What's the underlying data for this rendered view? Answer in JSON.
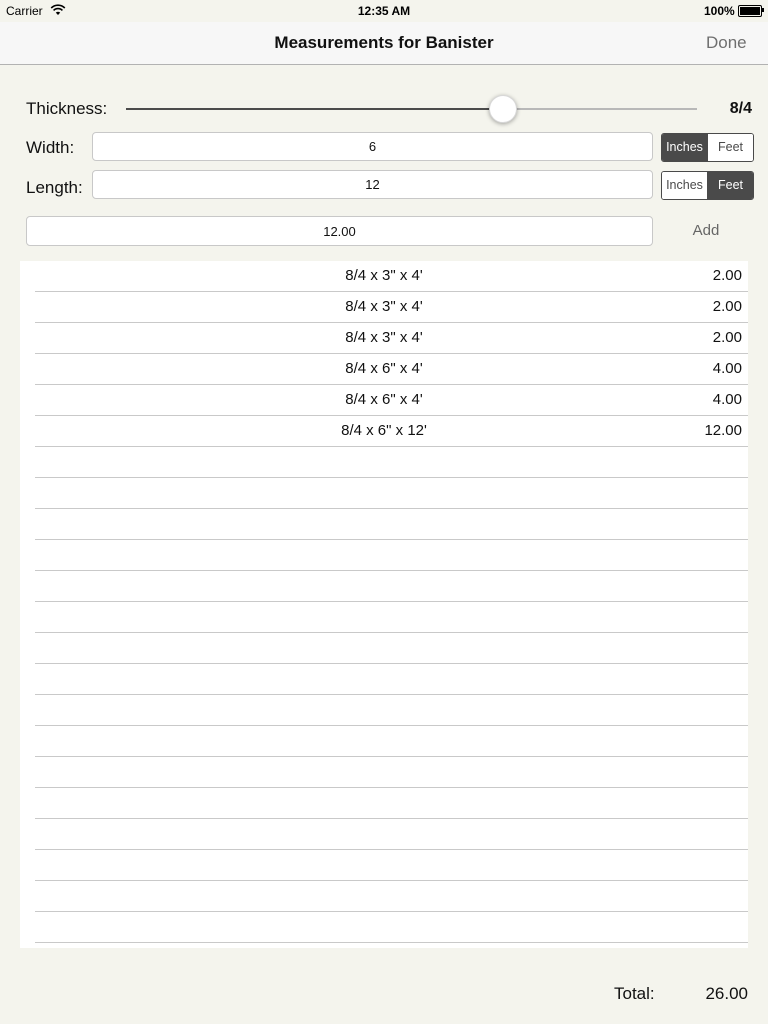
{
  "status_bar": {
    "carrier": "Carrier",
    "time": "12:35 AM",
    "battery": "100%",
    "wifi_icon": "wifi-icon",
    "battery_icon": "battery-icon"
  },
  "nav": {
    "title": "Measurements for Banister",
    "done_label": "Done"
  },
  "form": {
    "thickness_label": "Thickness:",
    "thickness_value": "8/4",
    "thickness_slider_fraction": 0.66,
    "width_label": "Width:",
    "width_value": "6",
    "width_unit": {
      "options": [
        "Inches",
        "Feet"
      ],
      "selected": "Inches"
    },
    "length_label": "Length:",
    "length_value": "12",
    "length_unit": {
      "options": [
        "Inches",
        "Feet"
      ],
      "selected": "Feet"
    },
    "result_value": "12.00",
    "add_label": "Add"
  },
  "table": {
    "rows": [
      {
        "label": "8/4 x 3\" x 4'",
        "value": "2.00"
      },
      {
        "label": "8/4 x 3\" x 4'",
        "value": "2.00"
      },
      {
        "label": "8/4 x 3\" x 4'",
        "value": "2.00"
      },
      {
        "label": "8/4 x 6\" x 4'",
        "value": "4.00"
      },
      {
        "label": "8/4 x 6\" x 4'",
        "value": "4.00"
      },
      {
        "label": "8/4 x 6\" x 12'",
        "value": "12.00"
      }
    ]
  },
  "footer": {
    "total_label": "Total:",
    "total_value": "26.00"
  }
}
